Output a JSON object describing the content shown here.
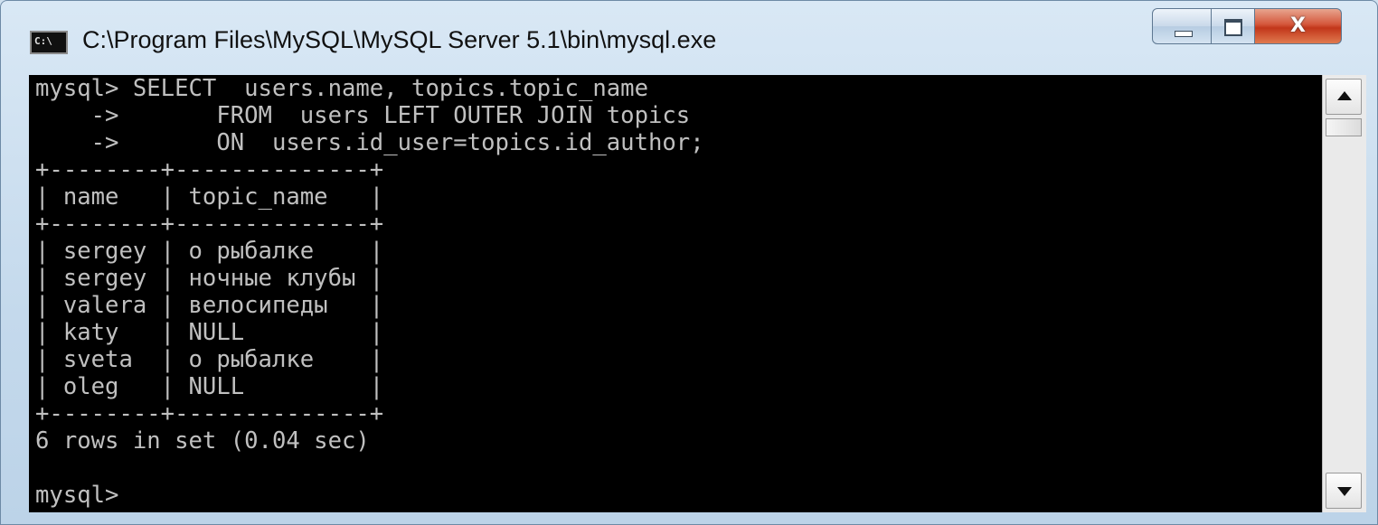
{
  "window": {
    "title": "C:\\Program Files\\MySQL\\MySQL Server 5.1\\bin\\mysql.exe",
    "icon_text": "C:\\",
    "icon_name": "console-app-icon",
    "controls": {
      "minimize": "minimize-icon",
      "maximize": "maximize-icon",
      "close_glyph": "X"
    }
  },
  "console": {
    "background": "#000000",
    "foreground": "#c0c0c0",
    "lines": [
      "mysql> SELECT  users.name, topics.topic_name",
      "    ->       FROM  users LEFT OUTER JOIN topics",
      "    ->       ON  users.id_user=topics.id_author;",
      "+--------+--------------+",
      "| name   | topic_name   |",
      "+--------+--------------+",
      "| sergey | о рыбалке    |",
      "| sergey | ночные клубы |",
      "| valera | велосипеды   |",
      "| katy   | NULL         |",
      "| sveta  | о рыбалке    |",
      "| oleg   | NULL         |",
      "+--------+--------------+",
      "6 rows in set (0.04 sec)",
      "",
      "mysql>"
    ],
    "result_table": {
      "columns": [
        "name",
        "topic_name"
      ],
      "rows": [
        [
          "sergey",
          "о рыбалке"
        ],
        [
          "sergey",
          "ночные клубы"
        ],
        [
          "valera",
          "велосипеды"
        ],
        [
          "katy",
          "NULL"
        ],
        [
          "sveta",
          "о рыбалке"
        ],
        [
          "oleg",
          "NULL"
        ]
      ],
      "summary": "6 rows in set (0.04 sec)"
    },
    "prompt": "mysql>"
  },
  "scrollbar": {
    "up_icon": "scroll-up-arrow-icon",
    "down_icon": "scroll-down-arrow-icon"
  }
}
